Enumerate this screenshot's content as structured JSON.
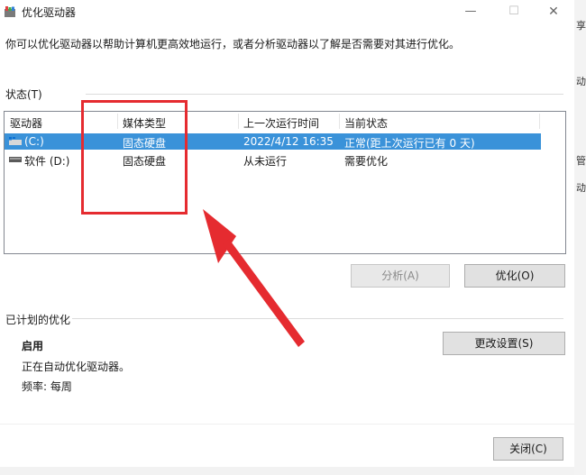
{
  "window": {
    "title": "优化驱动器",
    "controls": {
      "minimize": "—",
      "maximize": "☐",
      "close": "✕"
    },
    "description": "你可以优化驱动器以帮助计算机更高效地运行，或者分析驱动器以了解是否需要对其进行优化。"
  },
  "status": {
    "label": "状态(T)",
    "columns": [
      "驱动器",
      "媒体类型",
      "上一次运行时间",
      "当前状态"
    ],
    "rows": [
      {
        "drive": "(C:)",
        "media": "固态硬盘",
        "last_run": "2022/4/12 16:35",
        "status": "正常(距上次运行已有 0 天)",
        "selected": true,
        "icon": "windows-drive-icon"
      },
      {
        "drive": "软件 (D:)",
        "media": "固态硬盘",
        "last_run": "从未运行",
        "status": "需要优化",
        "selected": false,
        "icon": "hard-drive-icon"
      }
    ]
  },
  "buttons": {
    "analyze": "分析(A)",
    "optimize": "优化(O)",
    "change_settings": "更改设置(S)",
    "close": "关闭(C)"
  },
  "schedule": {
    "label": "已计划的优化",
    "state": "启用",
    "description": "正在自动优化驱动器。",
    "frequency": "频率: 每周"
  },
  "background_window": {
    "fragments": [
      "享",
      "动",
      "管",
      "动"
    ]
  },
  "colors": {
    "selection": "#3a92d9",
    "annotation": "#e52b30"
  }
}
